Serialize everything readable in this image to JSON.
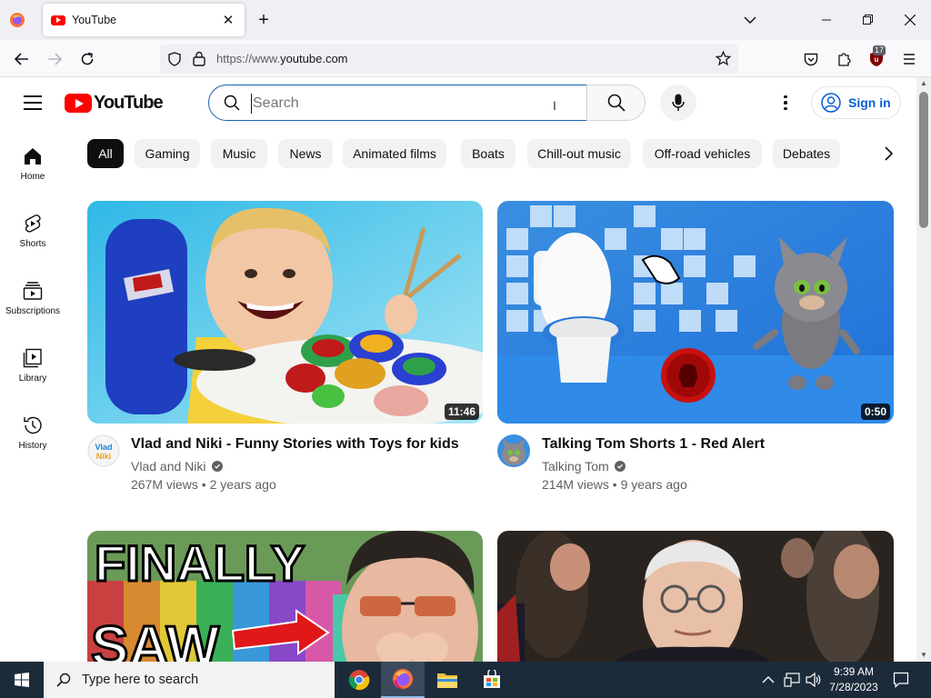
{
  "browser": {
    "tab_title": "YouTube",
    "url_prefix": "https://www.",
    "url_domain": "youtube.com",
    "ext_badge": "17"
  },
  "header": {
    "logo_text": "YouTube",
    "search_placeholder": "Search",
    "sign_in_label": "Sign in"
  },
  "sidebar": {
    "items": [
      {
        "label": "Home",
        "icon": "home-icon"
      },
      {
        "label": "Shorts",
        "icon": "shorts-icon"
      },
      {
        "label": "Subscriptions",
        "icon": "subscriptions-icon"
      },
      {
        "label": "Library",
        "icon": "library-icon"
      },
      {
        "label": "History",
        "icon": "history-icon"
      }
    ]
  },
  "chips": [
    "All",
    "Gaming",
    "Music",
    "News",
    "Animated films",
    "Boats",
    "Chill-out music",
    "Off-road vehicles",
    "Debates"
  ],
  "videos": [
    {
      "title": "Vlad and Niki - Funny Stories with Toys for kids",
      "channel": "Vlad and Niki",
      "meta": "267M views • 2 years ago",
      "duration": "11:46"
    },
    {
      "title": "Talking Tom Shorts 1 - Red Alert",
      "channel": "Talking Tom",
      "meta": "214M views • 9 years ago",
      "duration": "0:50"
    },
    {
      "thumb_text_1": "FINALLY",
      "thumb_text_2": "SAW"
    },
    {}
  ],
  "taskbar": {
    "search_placeholder": "Type here to search",
    "time": "9:39 AM",
    "date": "7/28/2023"
  },
  "colors": {
    "yt_red": "#ff0000",
    "link_blue": "#065fd4",
    "search_focus": "#1c62b9",
    "taskbar": "#1c2b3a"
  }
}
